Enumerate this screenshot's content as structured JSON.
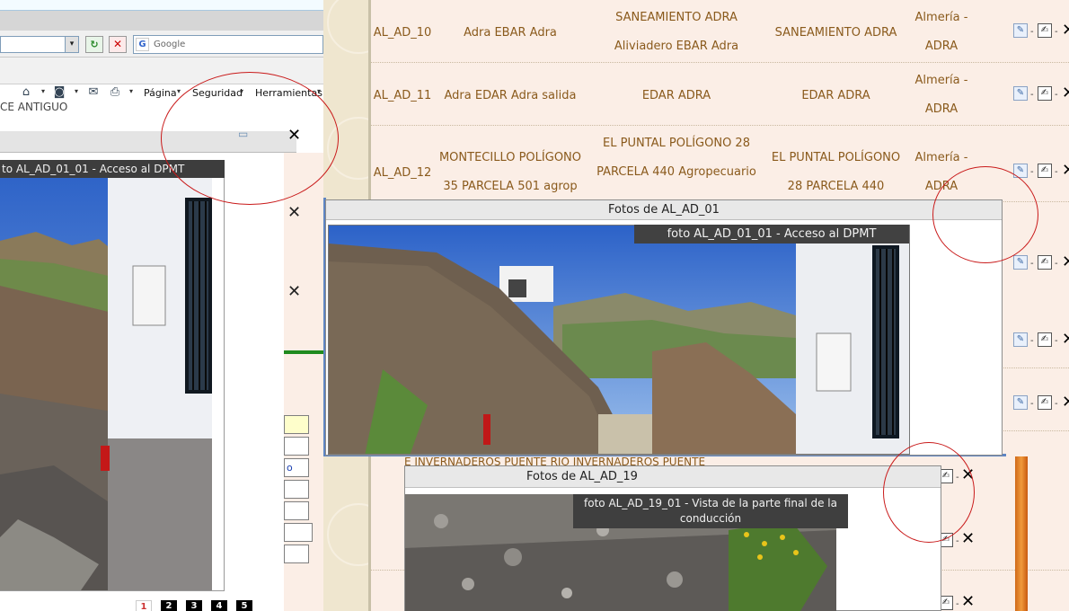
{
  "left_browser": {
    "address_dropdown": "▾",
    "go_symbol": "↻",
    "stop_symbol": "✕",
    "search_placeholder": "Google",
    "google_logo": "G",
    "commands": [
      {
        "label": "Página"
      },
      {
        "label": "Seguridad"
      },
      {
        "label": "Herramientas"
      }
    ],
    "page_strip_text": "CE ANTIGUO",
    "photo_caption": "to AL_AD_01_01 - Acceso al DPMT",
    "input_o_text": "o",
    "pagination": [
      "1",
      "2",
      "3",
      "4",
      "5"
    ]
  },
  "table": {
    "rows": [
      {
        "code": "AL_AD_10",
        "name": "Adra EBAR Adra",
        "system_l1": "SANEAMIENTO ADRA",
        "system_l2": "Aliviadero EBAR Adra",
        "zone": "SANEAMIENTO ADRA",
        "muni_l1": "Almería -",
        "muni_l2": "ADRA"
      },
      {
        "code": "AL_AD_11",
        "name": "Adra EDAR Adra salida",
        "system_l1": "EDAR ADRA",
        "system_l2": "",
        "zone": "EDAR ADRA",
        "muni_l1": "Almería -",
        "muni_l2": "ADRA"
      },
      {
        "code": "AL_AD_12",
        "name_l1": "MONTECILLO POLÍGONO",
        "name_l2": "35 PARCELA 501 agrop",
        "system_l1": "EL PUNTAL POLÍGONO 28",
        "system_l2": "PARCELA 440 Agropecuario",
        "zone_l1": "EL PUNTAL POLÍGONO",
        "zone_l2": "28 PARCELA 440",
        "muni_l1": "Almería -",
        "muni_l2": "ADRA"
      }
    ],
    "overlap_text": "E   INVERNADEROS PUENTE RIO   INVERNADEROS PUENTE"
  },
  "dialogs": {
    "main": {
      "title": "Fotos de AL_AD_01",
      "caption": "foto AL_AD_01_01 - Acceso al DPMT"
    },
    "ad19": {
      "title": "Fotos de AL_AD_19",
      "caption_l1": "foto AL_AD_19_01 - Vista de la parte final de la",
      "caption_l2": "conducción"
    }
  },
  "icons": {
    "view": "view-icon",
    "edit": "edit-icon",
    "delete": "delete-icon",
    "delete_symbol": "✕",
    "dot": "-"
  }
}
